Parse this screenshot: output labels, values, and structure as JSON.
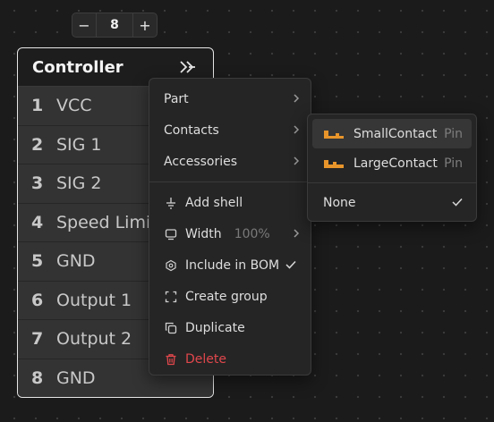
{
  "stepper": {
    "decrement": "−",
    "value": "8",
    "increment": "+"
  },
  "controller": {
    "title": "Controller",
    "rows": [
      {
        "num": "1",
        "label": "VCC"
      },
      {
        "num": "2",
        "label": "SIG 1"
      },
      {
        "num": "3",
        "label": "SIG 2"
      },
      {
        "num": "4",
        "label": "Speed Limit"
      },
      {
        "num": "5",
        "label": "GND"
      },
      {
        "num": "6",
        "label": "Output 1"
      },
      {
        "num": "7",
        "label": "Output 2"
      },
      {
        "num": "8",
        "label": "GND"
      }
    ]
  },
  "menu": {
    "part": "Part",
    "contacts": "Contacts",
    "accessories": "Accessories",
    "add_shell": "Add shell",
    "width": "Width",
    "width_value": "100%",
    "include_bom": "Include in BOM",
    "create_group": "Create group",
    "duplicate": "Duplicate",
    "delete": "Delete"
  },
  "contacts_menu": {
    "items": [
      {
        "label": "SmallContact",
        "tag": "Pin"
      },
      {
        "label": "LargeContact",
        "tag": "Pin"
      }
    ],
    "none": "None"
  },
  "colors": {
    "accent_orange": "#e8952b",
    "danger": "#e0474c"
  }
}
